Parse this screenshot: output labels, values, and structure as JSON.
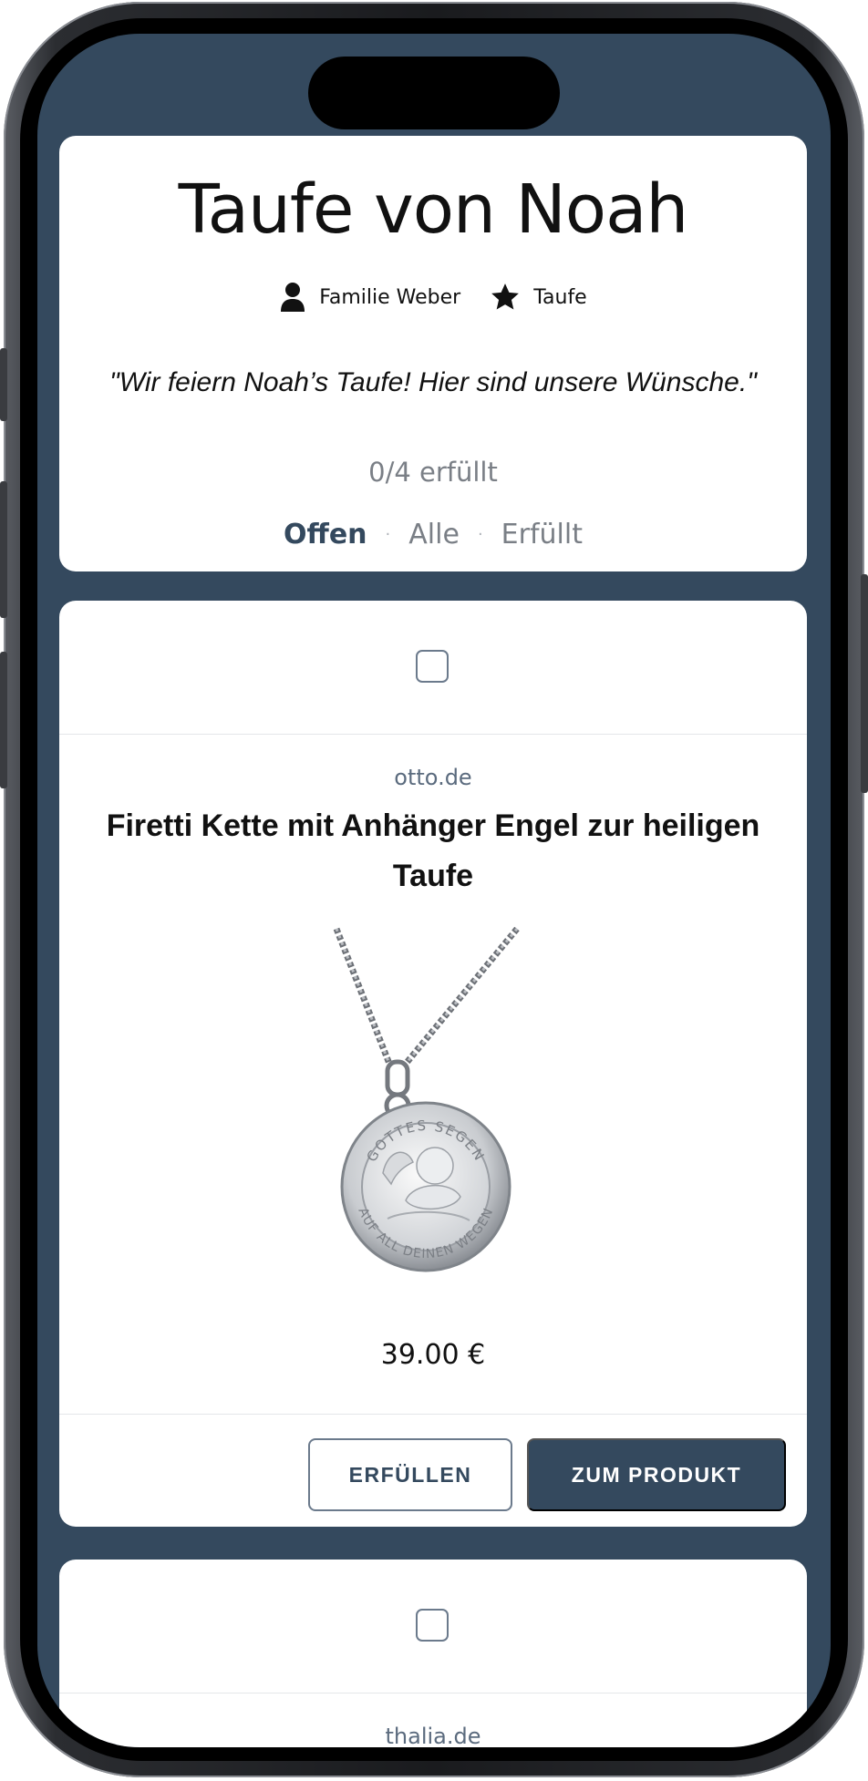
{
  "header": {
    "title": "Taufe von Noah",
    "owner": "Familie Weber",
    "occasion": "Taufe",
    "quote": "\"Wir feiern Noah’s Taufe! Hier sind unsere Wünsche.\"",
    "progress": "0/4 erfüllt"
  },
  "filters": {
    "open": "Offen",
    "all": "Alle",
    "done": "Erfüllt",
    "separator": "·",
    "active": "Offen"
  },
  "items": [
    {
      "store": "otto.de",
      "title": "Firetti Kette mit Anhänger Engel zur heiligen Taufe",
      "price": "39.00 €",
      "checked": false,
      "pendant_top_text": "GOTTES SEGEN",
      "pendant_bottom_text": "AUF ALL DEINEN WEGEN",
      "fulfill_label": "ERFÜLLEN",
      "product_label": "ZUM PRODUKT"
    },
    {
      "store": "thalia.de",
      "checked": false
    }
  ],
  "colors": {
    "frame_background": "#34495e",
    "primary": "#34495e",
    "muted": "#7a7f86"
  },
  "icons": {
    "owner": "person-icon",
    "occasion": "star-icon"
  }
}
